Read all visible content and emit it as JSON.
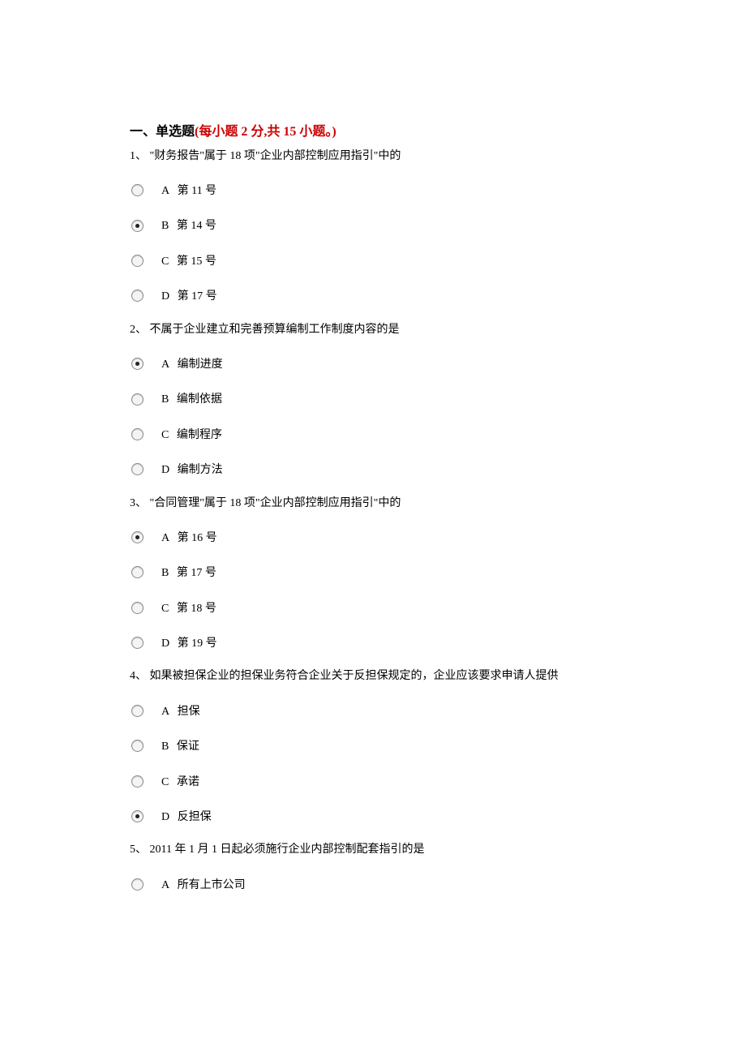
{
  "section": {
    "title_black": "一、单选题",
    "title_red": "(每小题 2 分,共 15 小题。)"
  },
  "questions": [
    {
      "num": "1、",
      "text": "\"财务报告\"属于 18 项\"企业内部控制应用指引\"中的",
      "options": [
        {
          "label": "A",
          "text": "第 11 号",
          "selected": false
        },
        {
          "label": "B",
          "text": "第 14 号",
          "selected": true
        },
        {
          "label": "C",
          "text": "第 15 号",
          "selected": false
        },
        {
          "label": "D",
          "text": "第 17 号",
          "selected": false
        }
      ]
    },
    {
      "num": "2、",
      "text": "不属于企业建立和完善预算编制工作制度内容的是",
      "options": [
        {
          "label": "A",
          "text": "编制进度",
          "selected": true
        },
        {
          "label": "B",
          "text": "编制依据",
          "selected": false
        },
        {
          "label": "C",
          "text": "编制程序",
          "selected": false
        },
        {
          "label": "D",
          "text": "编制方法",
          "selected": false
        }
      ]
    },
    {
      "num": "3、",
      "text": "\"合同管理\"属于 18 项\"企业内部控制应用指引\"中的",
      "options": [
        {
          "label": "A",
          "text": "第 16 号",
          "selected": true
        },
        {
          "label": "B",
          "text": "第 17 号",
          "selected": false
        },
        {
          "label": "C",
          "text": "第 18 号",
          "selected": false
        },
        {
          "label": "D",
          "text": "第 19 号",
          "selected": false
        }
      ]
    },
    {
      "num": "4、",
      "text": "如果被担保企业的担保业务符合企业关于反担保规定的，企业应该要求申请人提供",
      "options": [
        {
          "label": "A",
          "text": "担保",
          "selected": false
        },
        {
          "label": "B",
          "text": "保证",
          "selected": false
        },
        {
          "label": "C",
          "text": "承诺",
          "selected": false
        },
        {
          "label": "D",
          "text": "反担保",
          "selected": true
        }
      ]
    },
    {
      "num": "5、",
      "text": "2011 年 1 月 1 日起必须施行企业内部控制配套指引的是",
      "options": [
        {
          "label": "A",
          "text": "所有上市公司",
          "selected": false
        }
      ]
    }
  ]
}
